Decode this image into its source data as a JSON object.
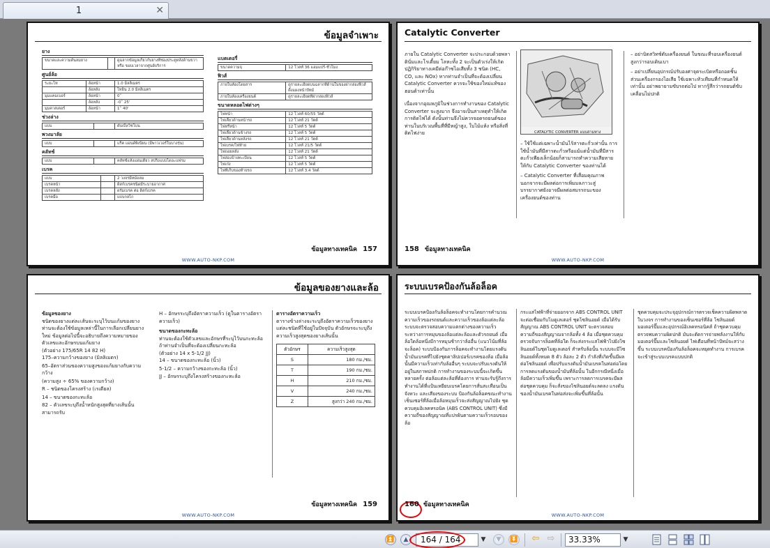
{
  "tab": {
    "label": "1"
  },
  "pages": {
    "p157": {
      "title": "ข้อมูลจำเพาะ",
      "footer_label": "ข้อมูลทางเทคนิค",
      "page_number": "157",
      "url": "WWW.AUTO-NKP.COM",
      "left_sections": [
        {
          "name": "ยาง",
          "rows": [
            [
              "ขนาดและความดันลมยาง",
              "",
              "ดูฉลากข้อมูลเกี่ยวกับยางที่ช่องประตูหลังด้านขวา หรือ ขอบเวลาจากศูนย์บริการ"
            ]
          ]
        },
        {
          "name": "ศูนย์ล้อ",
          "rows": [
            [
              "ระยะโท",
              "ล้อหน้า",
              "1.0 มิลลิเมตร"
            ],
            [
              "",
              "ล้อหลัง",
              "โทอิน 2.0 มิลลิเมตร"
            ],
            [
              "มุมแคมเบอร์",
              "ล้อหน้า",
              "0˚"
            ],
            [
              "",
              "ล้อหลัง",
              "-0˚ 25'"
            ],
            [
              "มุมคาสเตอร์",
              "ล้อหน้า",
              "1˚ 40'"
            ]
          ]
        },
        {
          "name": "ช่วงล่าง",
          "rows": [
            [
              "แบบ",
              "",
              "ดับเบิ้ลวิชโบน"
            ]
          ]
        },
        {
          "name": "พวงมาลัย",
          "rows": [
            [
              "แบบ",
              "",
              "แร็ค แอนด์พิเนียน (มีพาวเวอร์ในบางรุ่น)"
            ]
          ]
        },
        {
          "name": "คลัทช์",
          "rows": [
            [
              "แบบ",
              "",
              "คลัทช์แห้งแผ่นเดียว สปริงแบบไดอะแฟรม"
            ]
          ]
        },
        {
          "name": "เบรค",
          "rows": [
            [
              "แบบ",
              "",
              "2 วงจรมีหม้อลม"
            ],
            [
              "เบรคหน้า",
              "",
              "ดิสก์เบรคชนิดมีระบายอากาศ"
            ],
            [
              "เบรคหลัง",
              "",
              "ดรัมเบรค ต่อ ดิสก์เบรค"
            ],
            [
              "เบรคมือ",
              "",
              "แบบกลไก"
            ]
          ]
        }
      ],
      "right_sections": [
        {
          "name": "แบตเตอรี่",
          "rows": [
            [
              "ขนาดความจุ",
              "12 โวลท์ 36 แอมแปร์-ชั่วโมง"
            ]
          ]
        },
        {
          "name": "ฟิวส์",
          "rows": [
            [
              "ภายในห้องโดยสาร",
              "ดูรายละเอียดบนฉลากที่ด้านในของฝากล่องฟิวส์ดิ้งแผงหน้าปัทม์"
            ],
            [
              "ภายในห้องเครื่องยนต์",
              "ดูรายละเอียดที่ฝากล่องฟิวส์"
            ]
          ]
        },
        {
          "name": "ขนาดหลอดไฟต่างๆ",
          "rows": [
            [
              "ไฟหน้า",
              "12 โวลท์ 60/55 วัตต์"
            ],
            [
              "ไฟเลี้ยวด้านหน้ารถ",
              "12 โวลท์ 21 วัตต์"
            ],
            [
              "ไฟหรี่หน้า",
              "12 โวลท์ 5 วัตต์"
            ],
            [
              "ไฟเลี้ยวด้านข้างรถ",
              "12 โวลท์ 5 วัตต์"
            ],
            [
              "ไฟเลี้ยวด้านหลังรถ",
              "12 โวลท์ 21 วัตต์"
            ],
            [
              "ไฟเบรค/ไฟท้าย",
              "12 โวลท์ 21/5 วัตต์"
            ],
            [
              "ไฟถอยหลัง",
              "12 โวลท์ 21 วัตต์"
            ],
            [
              "ไฟส่องป้ายทะเบียน",
              "12 โวลท์ 5 วัตต์"
            ],
            [
              "ไฟเก๋ง",
              "12 โวลท์ 5 วัตต์"
            ],
            [
              "ไฟที่เก็บของท้ายรถ",
              "12 โวลท์ 3.4 วัตต์"
            ]
          ]
        }
      ]
    },
    "p158": {
      "title": "Catalytic Converter",
      "footer_label": "ข้อมูลทางเทคนิค",
      "page_number": "158",
      "url": "WWW.AUTO-NKP.COM",
      "col1": [
        "ภายใน Catalytic Converter จะประกอบด้วยพลาตินั่มและโรเดี้ยม โลหะทั้ง 2 จะเป็นตัวเร่งให้เกิดปฏิกิริยาทางเคมีต่อก๊าซไอเสียทั้ง 3 ชนิด (HC, CO, และ NOx) หากท่านจำเป็นที่จะต้องเปลี่ยน Catalytic Converter ควรจะใช้ของใหม่แท้ของฮอนด้าเท่านั้น",
        "เนื่องจากอุณหภูมิในช่วงการทำงานของ Catalytic Converter จะสูงมาก จึงอาจเป็นสาเหตุทำให้เกิดการติดไฟได้ ดังนั้นท่านจึงไม่ควรจอดรถยนต์ของท่านในบริเวณพื้นที่ที่มีหญ้าสูง, ใบไม้แห้ง หรือสิ่งที่ติดไฟง่าย"
      ],
      "figure_caption": "CATALYTIC CONVERTER แบบสามทาง",
      "col2": [
        "ใช้ใช้แต่เฉพาะน้ำมันไร้สารตะกั่วเท่านั้น การใช้น้ำมันที่มีสารตะกั่วหรือแม้แต่น้ำมันที่มีสารตะกั่วเพียงเล็กน้อยก็สามารถทำความเสียหายให้กับ Catalytic Converter ของท่านได้",
        "Catalytic Converter ที่เสื่อมคุณภาพนอกจากจะมีผลต่อการเพิ่มมลภาวะสู่บรรยากาศยังอาจมีผลต่อสมรรถนะของเครื่องยนต์ของท่าน"
      ],
      "col3": [
        "อย่าบิดสวิทช์ดับเครื่องยนต์ ในขณะที่รอบเครื่องยนต์สูงกว่ารอบเดินเบา",
        "อย่าเปลี่ยนอุปกรณ์ปรับองศาจุดระเบิดหรือถอดชิ้นส่วนเครื่องกรองไอเสีย ใช้เฉพาะหัวเทียนที่กำหนดให้เท่านั้น อย่าพยายามขับรถต่อไป หากรู้สึกว่ารถยนต์ขับเคลื่อนไม่ปกติ"
      ]
    },
    "p159": {
      "title": "ข้อมูลของยางและล้อ",
      "footer_label": "ข้อมูลทางเทคนิค",
      "page_number": "159",
      "url": "WWW.AUTO-NKP.COM",
      "col1_heading": "ข้อมูลของยาง",
      "col1_intro": "ชนิดของยางแต่ละเส้นจะระบุไว้บนแก้มของยาง ท่านจะต้องใช้ข้อมูลเหล่านี้ในการเลือกเปลี่ยนยางใหม่ ข้อมูลต่อไปนี้จะอธิบายถึงความหมายของตัวเลขและอักษรบนแก้มยาง",
      "col1_example": "(ตัวอย่าง 175/65R 14 82 H)",
      "col1_items": [
        "175–ความกว้างของยาง (มิลลิเมตร)",
        "65–อัตราส่วนของความสูงของแก้มยางกับความกว้าง",
        "(ความสูง ÷ 65% ของความกว้าง)",
        "R – ชนิดของโครงสร้าง (เรเดียล)",
        "14 – ขนาดของกะทะล้อ",
        "82 – ตัวเลขระบุถึงน้ำหนักสูงสุดที่ยางเส้นนั้นสามารถรับ"
      ],
      "col2_items": [
        "H – อักษรระบุถึงอัตราความเร็ว (ดูในตารางอัตราความเร็ว)"
      ],
      "col2_heading": "ขนาดของกะทะล้อ",
      "col2_intro": "ท่านจะต้องใช้ตัวเลขและอักษรที่ระบุไว้บนกะทะล้อ ถ้าท่านจำเป็นที่จะต้องเปลี่ยนกะทะล้อ",
      "col2_example": "(ตัวอย่าง 14 x 5-1/2 JJ)",
      "col2_items2": [
        "14 – ขนาดของกะทะล้อ (นิ้ว)",
        "5-1/2 – ความกว้างของกะทะล้อ (นิ้ว)",
        "JJ – อักษรระบุถึงโครงสร้างของกะทะล้อ"
      ],
      "col3_heading": "ตารางอัตราความเร็ว",
      "col3_intro": "ตารางข้างล่างจะระบุถึงอัตราความเร็วของยางแต่ละชนิดที่ใช้อยู่ในปัจจุบัน ตัวอักษรจะระบุถึงความเร็วสูงสุดของยางเส้นนั้น",
      "speed_table": {
        "headers": [
          "ตัวอักษร",
          "ความเร็วสูงสุด"
        ],
        "rows": [
          [
            "S",
            "180 กม./ชม."
          ],
          [
            "T",
            "190 กม./ชม."
          ],
          [
            "H",
            "210 กม./ชม."
          ],
          [
            "V",
            "240 กม./ชม."
          ],
          [
            "Z",
            "สูงกว่า 240 กม./ชม."
          ]
        ]
      }
    },
    "p160": {
      "title": "ระบบเบรคป้องกันล้อล็อค",
      "footer_label": "ข้อมูลทางเทคนิค",
      "page_number": "160",
      "url": "WWW.AUTO-NKP.COM",
      "col1": "ระบบเบรคป้องกันล้อล็อคจะทำงานโดยการคำนวณความเร็วของรถยนต์และความเร็วของล้อแต่ละล้อ ระบบจะตรวจสอบความแตกต่างของความเร็วระหว่างการหมุนของล้อแต่ละล้อและตัวรถยนต์ เมื่อล้อใดล้อหนึ่งมีการหมุนช้ากว่าล้ออื่น (แนวโน้มที่ล้อจะล็อค) ระบบป้องกันการล็อคจะทำงานโดยแรงดันน้ำมันเบรคที่ไปยังชุดคาลิปเปอร์เบรคของล้อ เมื่อล้อนั้นมีความเร็วเท่ากับล้ออื่นๆ ระบบจะปรับแรงดันให้อยู่ในสภาพปกติ การทำงานของระบบนี้จะเกิดขึ้นหลายครั้ง ต่อล้อแต่ละล้อที่ต้องการ ท่านจะรับรู้ถึงการทำงานได้ที่แป้นเหยียบเบรคโดยการสั่นสะเทือนเป็นจังหวะ และเสียงของระบบ ป้องกันล้อล็อคขณะทำงาน เซ็นเซอร์ที่ล้อเมื่อล้อหมุนเร็วจะส่งสัญญาณไปยัง ชุดควบคุมอิเลคทรอนิค (ABS CONTROL UNIT) ซึ่งมีความถี่ของสัญญาณที่แปรผันตามความเร็วรอบของล้อ",
      "col2": "กระแสไฟฟ้าที่จ่ายออกจาก ABS CONTROL UNIT จะต่อเชื่อมกับโมดูเลเตอร์ ชุดโซลินอยด์ เมื่อได้รับสัญญาณ ABS CONTROL UNIT จะตรวจสอบความถี่ของสัญญาณจากล้อทั้ง 4 ล้อ เมื่อชุดควบคุมตรวจจับการล็อคที่ล้อใด ก็จะส่งกระแสไฟฟ้าไปยังโซลินอยด์ในชุดโมดูเลเตอร์ สำหรับล้อนั้น ระบบจะมีโซลินอยด์ทั้งหมด 8 ตัว ล้อละ 2 ตัว กำลังที่เกิดขึ้นมีผลต่อโซลินอยด์ เพื่อปรับแรงดันน้ำมันเบรคในท่อต่อโดยการลดแรงดันของน้ำมันที่ล้อนั้น ในอีกกรณีหนึ่งเมื่อล้อมีความเร็วเพิ่มขึ้น เพราะการลดการเบรคจะมีผลต่อชุดควบคุม ก็จะสั่งของโซลินอยด์จะลดลง แรงดันของน้ำมันเบรคในท่อส่งจะเพิ่มขึ้นที่ล้อนั้น",
      "col3": "ชุดควบคุมจะประจุอุปกรณ์การตรวจเช็คความผิดพลาดในวงจร การทำงานของเซ็นเซอร์ที่ล้อ โซลินอยด์ มอเตอร์ปั๊มและอุปกรณ์อิเลคทรอนิคส์ ถ้าชุดควบคุมตรวจพบความผิดปกติ มันจะตัดการจ่ายพลังงานให้กับมอเตอร์ปั๊มและโซลินอยด์ ไฟเตือนที่หน้าปัทม์จะสว่างขึ้น ระบบเบรคป้องกันล้อล็อคจะหยุดทำงาน การเบรคจะเข้าสู่ระบบเบรคแบบปกติ"
    }
  },
  "toolbar": {
    "page_display": "164 / 164",
    "zoom_display": "33.33%"
  }
}
